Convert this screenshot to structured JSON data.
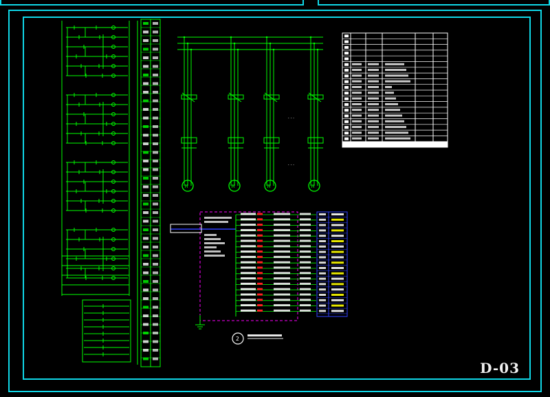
{
  "drawing": {
    "sheet_number": "D-03",
    "diagram_number": "2"
  },
  "colors": {
    "frame": "#10d8e8",
    "wire": "#00ff00",
    "table": "#ffffff",
    "panel_box": "#ff00ff",
    "terminal_box": "#3040ff",
    "accent_yellow": "#ffff00",
    "accent_red": "#ff2020"
  },
  "motors": {
    "count": 4,
    "spare_marks": [
      "...",
      "..."
    ]
  }
}
